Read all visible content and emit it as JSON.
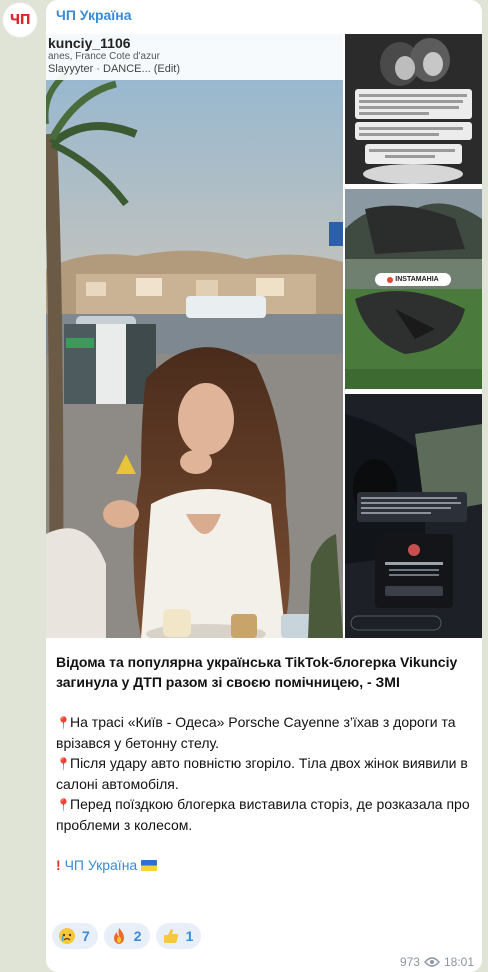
{
  "channel": {
    "name": "ЧП Україна",
    "avatar_text": "ЧП"
  },
  "story": {
    "username": "kunciy_1106",
    "location": "anes, France Cote d'azur",
    "song": "Slayyyter · DANCE... (Edit)"
  },
  "side_images": {
    "crash_badge": "INSTAMAHIA"
  },
  "post": {
    "headline": "Відома та популярна українська TikTok-блогерка Vikunciy загинула у ДТП разом зі своєю помічницею, - ЗМІ",
    "bullets": [
      "На трасі «Київ - Одеса» Porsche Cayenne з’їхав з дороги та врізався у бетонну стелу.",
      "Після удару авто повністю згоріло. Тіла двох жінок виявили в салоні автомобіля.",
      "Перед поїздкою блогерка виставила сторіз, де розказала про проблеми з колесом."
    ],
    "signoff": "ЧП Україна"
  },
  "reactions": [
    {
      "icon": "crying-face-icon",
      "count": "7"
    },
    {
      "icon": "fire-icon",
      "count": "2"
    },
    {
      "icon": "thumbs-up-icon",
      "count": "1"
    }
  ],
  "meta": {
    "views": "973",
    "time": "18:01"
  },
  "colors": {
    "accent": "#3a8ad6",
    "logo": "#e0262c",
    "background": "#dfe4d6"
  }
}
